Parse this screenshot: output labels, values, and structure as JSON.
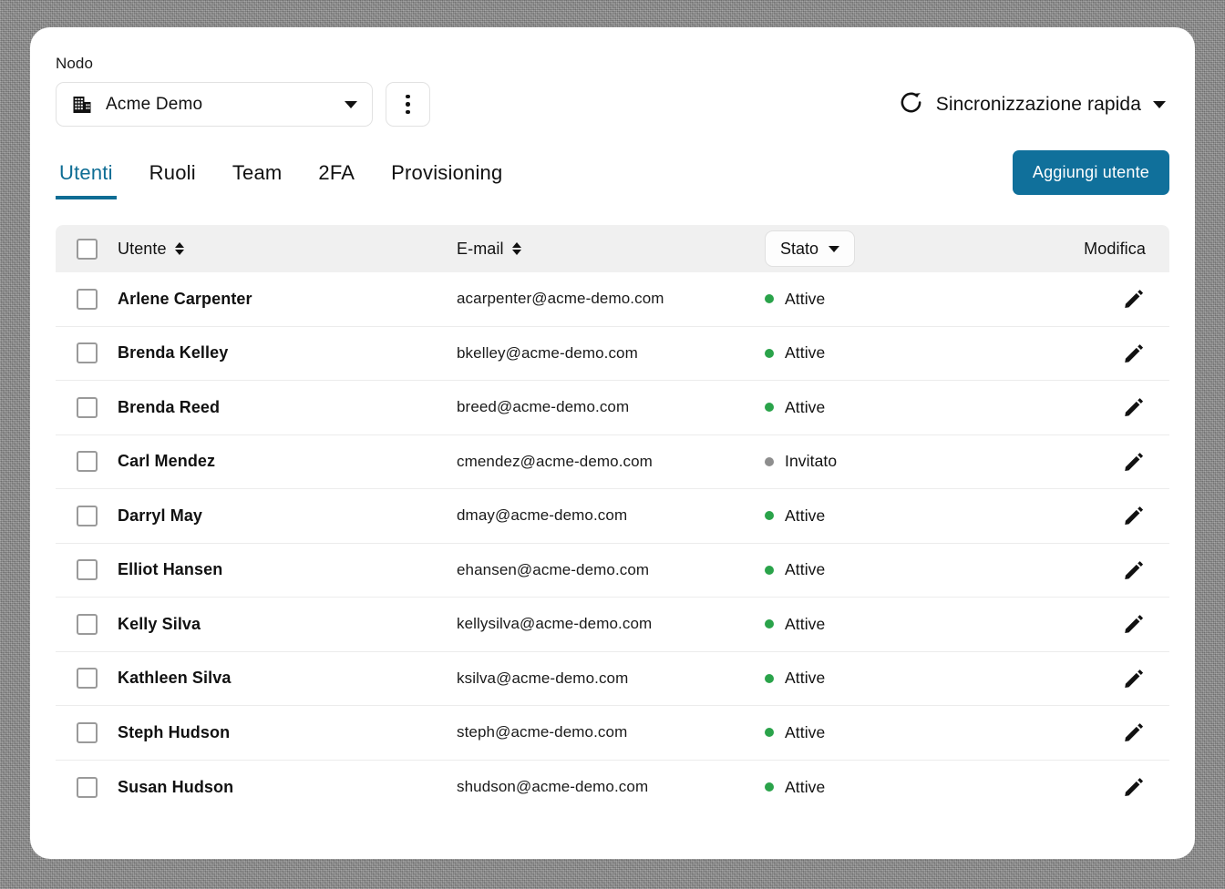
{
  "node": {
    "label": "Nodo",
    "selected": "Acme Demo",
    "icon": "building-icon",
    "menu_icon": "kebab-menu-icon"
  },
  "sync": {
    "label": "Sincronizzazione rapida",
    "icon": "refresh-icon"
  },
  "tabs": [
    {
      "label": "Utenti",
      "active": true
    },
    {
      "label": "Ruoli",
      "active": false
    },
    {
      "label": "Team",
      "active": false
    },
    {
      "label": "2FA",
      "active": false
    },
    {
      "label": "Provisioning",
      "active": false
    }
  ],
  "actions": {
    "add_user": "Aggiungi utente"
  },
  "table": {
    "headers": {
      "user": "Utente",
      "email": "E-mail",
      "status": "Stato",
      "edit": "Modifica"
    },
    "rows": [
      {
        "name": "Arlene Carpenter",
        "email": "acarpenter@acme-demo.com",
        "status": "Attive",
        "status_color": "#2aa34a"
      },
      {
        "name": "Brenda Kelley",
        "email": "bkelley@acme-demo.com",
        "status": "Attive",
        "status_color": "#2aa34a"
      },
      {
        "name": "Brenda Reed",
        "email": "breed@acme-demo.com",
        "status": "Attive",
        "status_color": "#2aa34a"
      },
      {
        "name": "Carl Mendez",
        "email": "cmendez@acme-demo.com",
        "status": "Invitato",
        "status_color": "#8e8e8e"
      },
      {
        "name": "Darryl May",
        "email": "dmay@acme-demo.com",
        "status": "Attive",
        "status_color": "#2aa34a"
      },
      {
        "name": "Elliot Hansen",
        "email": "ehansen@acme-demo.com",
        "status": "Attive",
        "status_color": "#2aa34a"
      },
      {
        "name": "Kelly Silva",
        "email": "kellysilva@acme-demo.com",
        "status": "Attive",
        "status_color": "#2aa34a"
      },
      {
        "name": "Kathleen Silva",
        "email": "ksilva@acme-demo.com",
        "status": "Attive",
        "status_color": "#2aa34a"
      },
      {
        "name": "Steph Hudson",
        "email": "steph@acme-demo.com",
        "status": "Attive",
        "status_color": "#2aa34a"
      },
      {
        "name": "Susan Hudson",
        "email": "shudson@acme-demo.com",
        "status": "Attive",
        "status_color": "#2aa34a"
      }
    ]
  },
  "colors": {
    "accent": "#10709b",
    "active_tab": "#0e6d94",
    "status_active": "#2aa34a",
    "status_invited": "#8e8e8e",
    "header_bg": "#f0f0f0"
  }
}
